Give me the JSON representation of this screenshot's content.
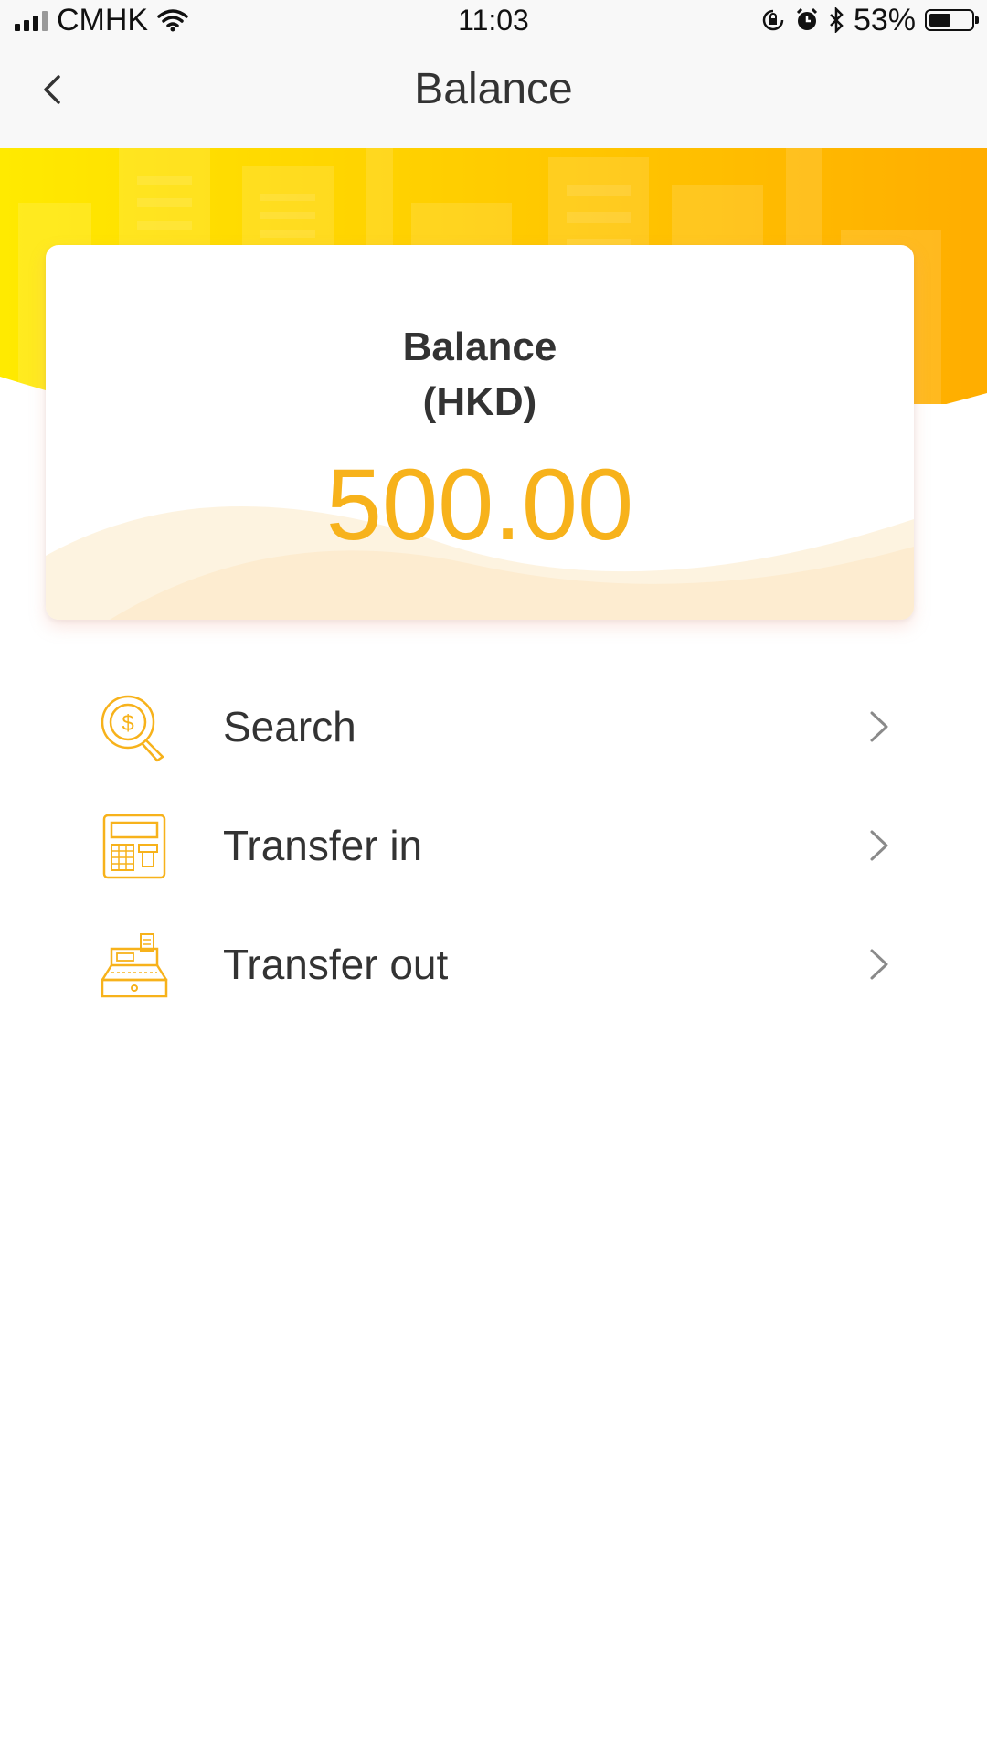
{
  "status_bar": {
    "carrier": "CMHK",
    "time": "11:03",
    "battery_percent": "53%",
    "battery_level": 0.53,
    "icons": [
      "signal-icon",
      "wifi-icon",
      "orientation-lock-icon",
      "alarm-icon",
      "bluetooth-icon",
      "battery-icon"
    ]
  },
  "nav": {
    "title": "Balance",
    "back_icon": "back-chevron-icon"
  },
  "card": {
    "label": "Balance",
    "currency": "(HKD)",
    "amount": "500.00"
  },
  "menu": {
    "items": [
      {
        "label": "Search",
        "icon": "money-search-icon"
      },
      {
        "label": "Transfer in",
        "icon": "atm-calculator-icon"
      },
      {
        "label": "Transfer out",
        "icon": "cash-register-icon"
      }
    ]
  },
  "colors": {
    "accent": "#f7b21b",
    "header_gradient_start": "#ffe600",
    "header_gradient_end": "#ffab00",
    "text": "#333333",
    "nav_background": "#f8f8f8"
  }
}
